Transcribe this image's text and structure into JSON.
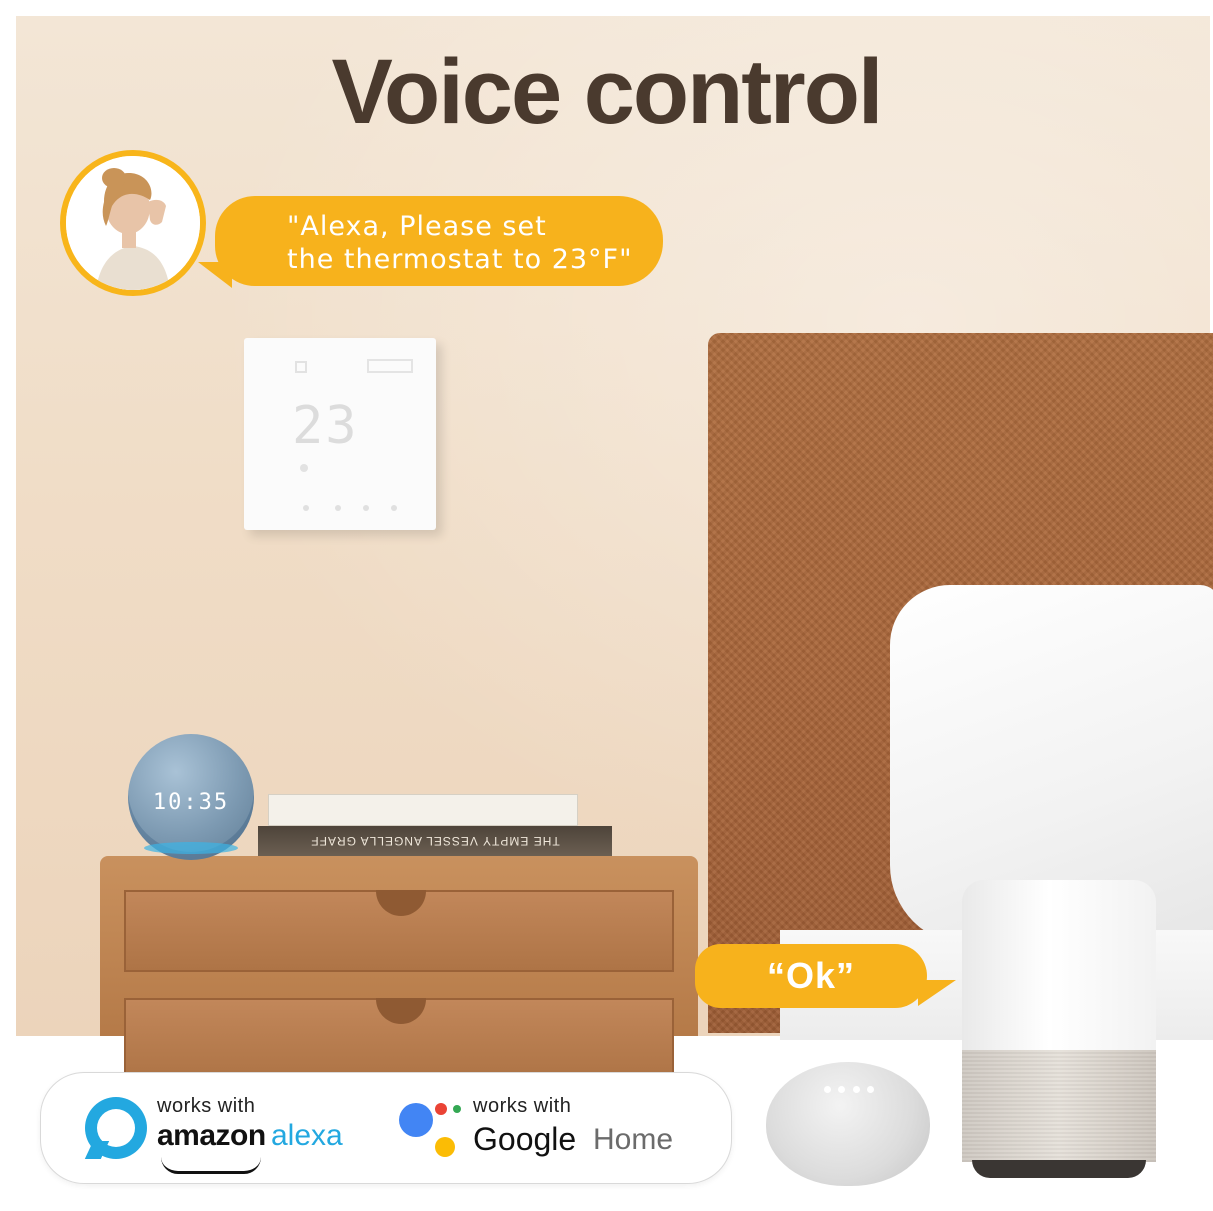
{
  "title": "Voice control",
  "alexa_request": {
    "line1": "\"Alexa, Please set",
    "line2": "the thermostat to 23°F\""
  },
  "google_reply": "“Ok”",
  "thermostat_display": "23",
  "echo_clock": "10:35",
  "books": {
    "spine_text": "THE EMPTY VESSEL   ANGELLA GRAFF"
  },
  "badges": {
    "alexa": {
      "works_with": "works with",
      "amazon": "amazon",
      "alexa": "alexa"
    },
    "google": {
      "works_with": "works with",
      "google": "Google",
      "home": "Home"
    }
  },
  "colors": {
    "bubble": "#f7b21c",
    "title": "#4a3a2e",
    "alexa_blue": "#23a8e0",
    "google_blue": "#4285f4",
    "google_red": "#ea4335",
    "google_yellow": "#fbbc05",
    "google_green": "#34a853"
  }
}
